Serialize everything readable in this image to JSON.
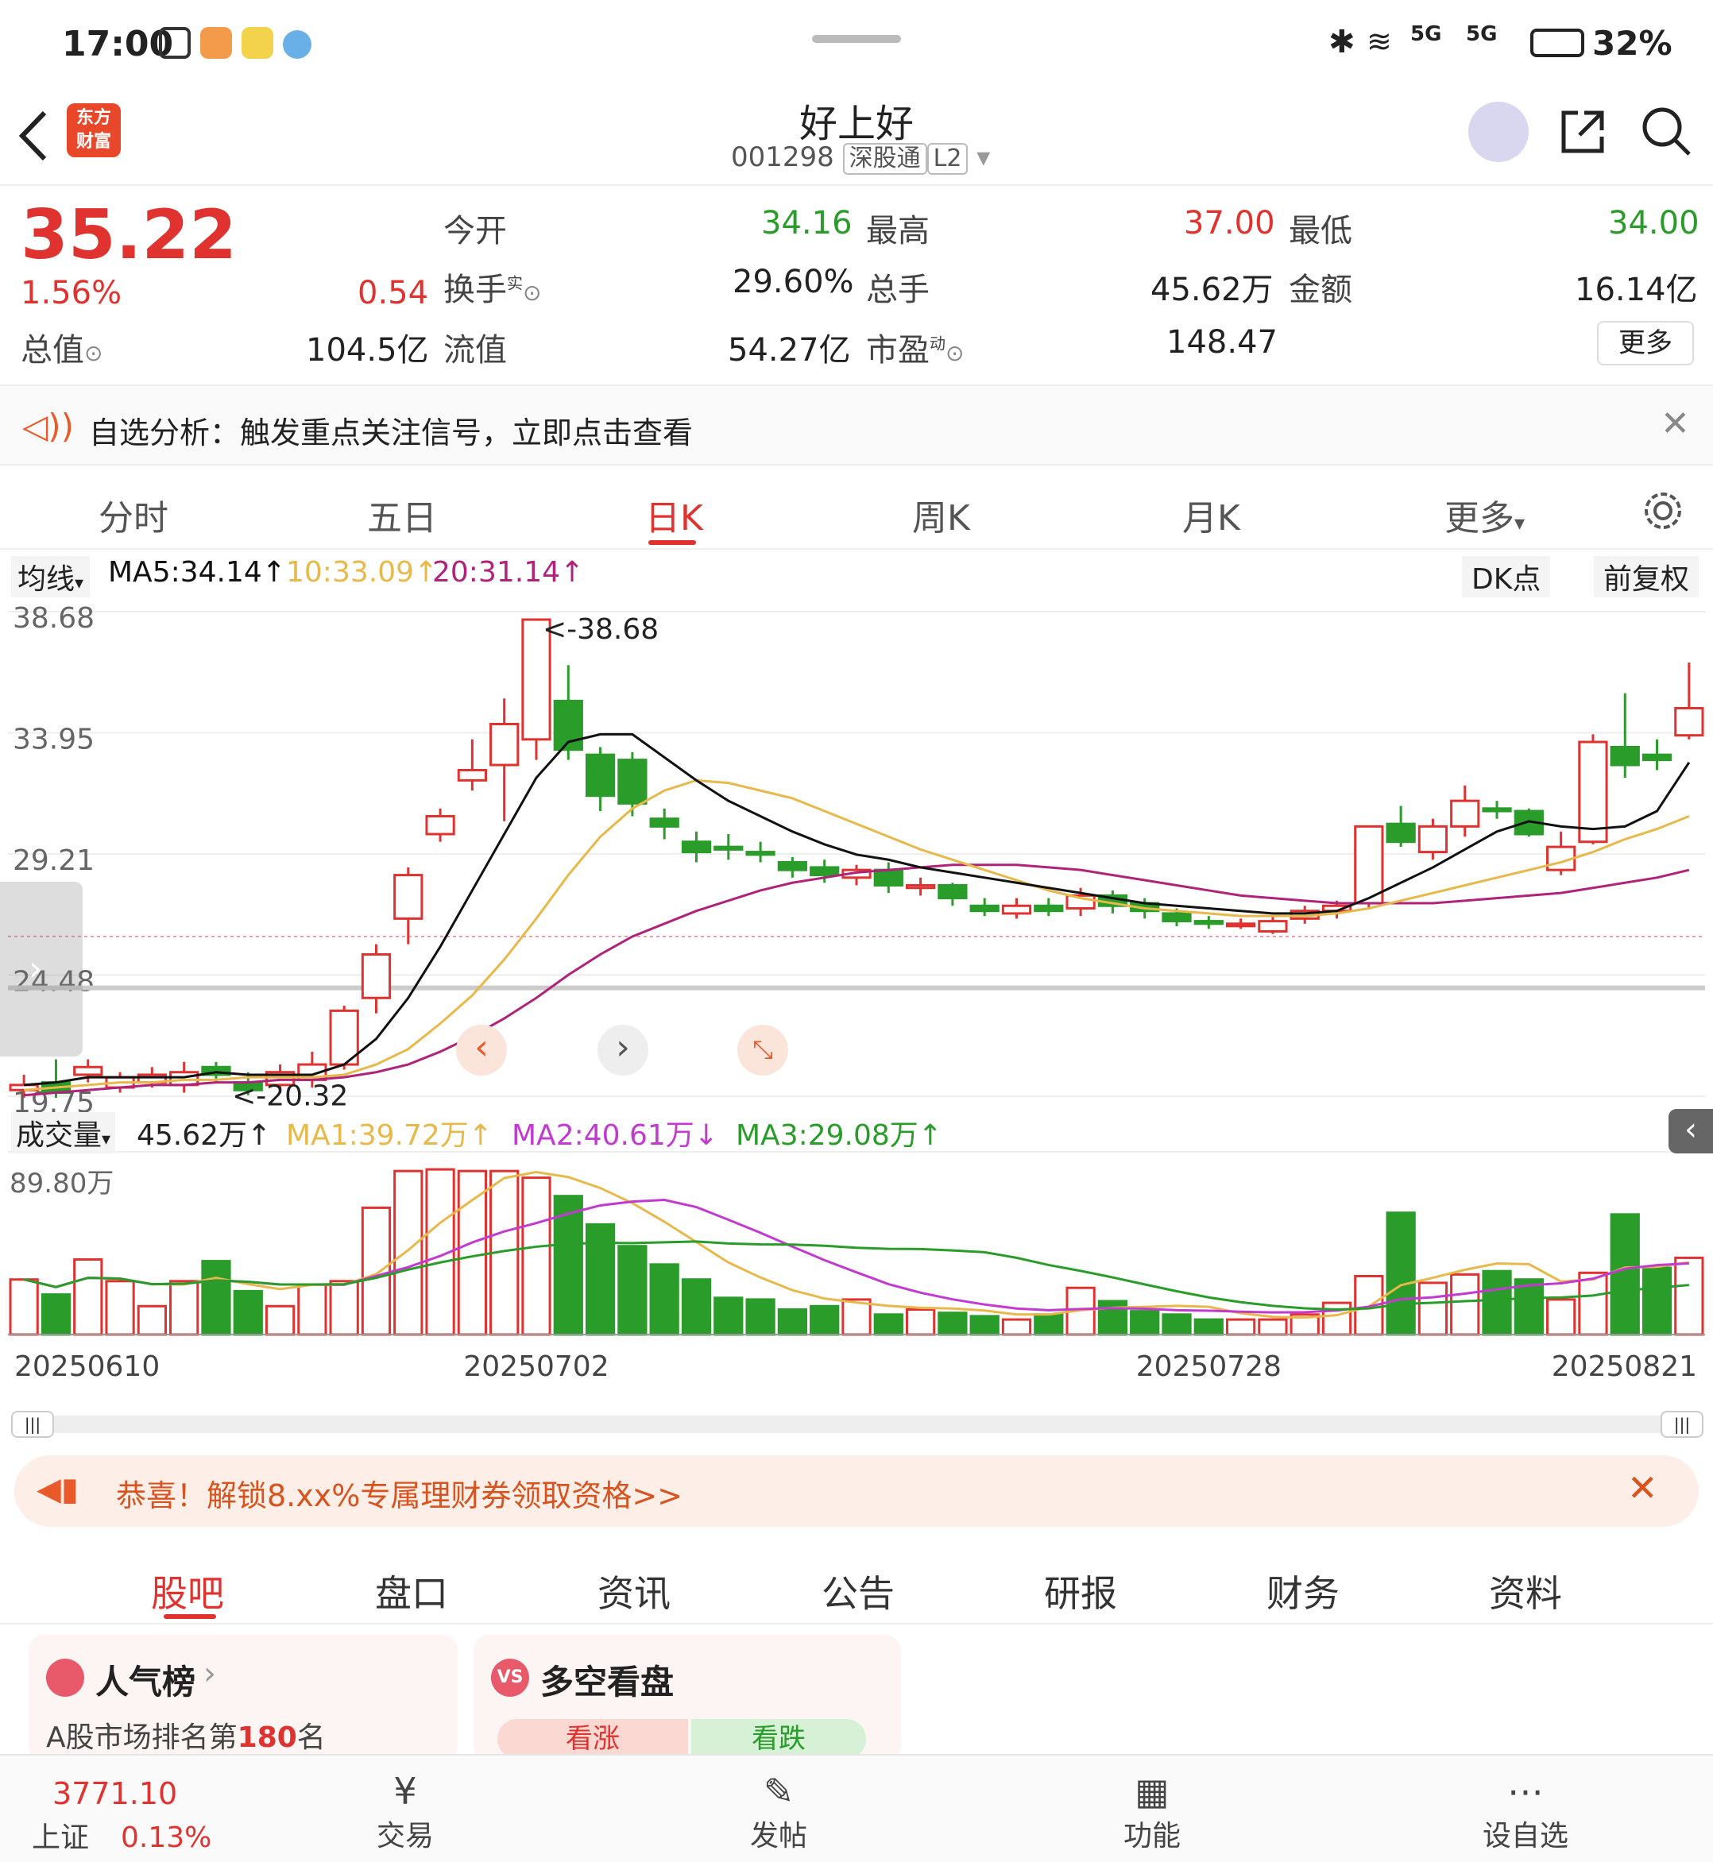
{
  "status": {
    "time": "17:00",
    "battery": "32%",
    "network_label": "5G"
  },
  "header": {
    "back_icon": "back-arrow-icon",
    "logo_line1": "东方",
    "logo_line2": "财富",
    "title": "好上好",
    "code": "001298",
    "badge_sh": "深股通",
    "badge_l2": "L2"
  },
  "quote": {
    "price": "35.22",
    "pct": "1.56%",
    "chg": "0.54",
    "total_value_label": "总值",
    "total_value": "104.5亿",
    "open_label": "今开",
    "open": "34.16",
    "turnover_label": "换手",
    "turnover_sup": "实",
    "turnover": "29.60%",
    "float_label": "流值",
    "float_value": "54.27亿",
    "high_label": "最高",
    "high": "37.00",
    "volume_label": "总手",
    "volume": "45.62万",
    "pe_label": "市盈",
    "pe_sup": "动",
    "pe": "148.47",
    "low_label": "最低",
    "low": "34.00",
    "amount_label": "金额",
    "amount": "16.14亿",
    "more": "更多"
  },
  "notice": {
    "text": "自选分析：触发重点关注信号，立即点击查看"
  },
  "ktabs": [
    "分时",
    "五日",
    "日K",
    "周K",
    "月K",
    "更多"
  ],
  "ma": {
    "label": "均线",
    "ma5": "MA5:34.14↑",
    "ma10": "10:33.09↑",
    "ma20": "20:31.14↑",
    "dk": "DK点",
    "fq": "前复权"
  },
  "chart_data": {
    "type": "candlestick",
    "ylabels": [
      "38.68",
      "33.95",
      "29.21",
      "24.48",
      "19.75"
    ],
    "ylim": [
      19.75,
      38.68
    ],
    "high_mark": "38.68",
    "low_mark": "20.32",
    "candles": [
      [
        20.3,
        20.5,
        20.0,
        20.9
      ],
      [
        20.6,
        20.2,
        20.0,
        21.5
      ],
      [
        20.9,
        21.2,
        20.6,
        21.5
      ],
      [
        20.4,
        20.8,
        20.2,
        21.0
      ],
      [
        20.6,
        20.9,
        20.4,
        21.2
      ],
      [
        20.5,
        21.0,
        20.2,
        21.4
      ],
      [
        21.2,
        20.9,
        20.6,
        21.4
      ],
      [
        20.6,
        20.3,
        20.1,
        21.0
      ],
      [
        20.5,
        21.0,
        20.2,
        21.3
      ],
      [
        20.7,
        21.3,
        20.4,
        21.8
      ],
      [
        21.3,
        23.4,
        21.1,
        23.6
      ],
      [
        23.9,
        25.6,
        23.3,
        26.0
      ],
      [
        27.0,
        28.7,
        26.0,
        29.0
      ],
      [
        30.3,
        31.0,
        30.0,
        31.3
      ],
      [
        32.4,
        32.8,
        32.0,
        34.0
      ],
      [
        33.0,
        34.6,
        30.8,
        35.6
      ],
      [
        34.0,
        38.68,
        33.2,
        38.68
      ],
      [
        35.5,
        33.6,
        33.2,
        36.9
      ],
      [
        33.4,
        31.8,
        31.2,
        33.7
      ],
      [
        33.2,
        31.5,
        31.0,
        33.5
      ],
      [
        30.9,
        30.6,
        30.1,
        31.3
      ],
      [
        30.0,
        29.6,
        29.2,
        30.4
      ],
      [
        29.8,
        29.7,
        29.3,
        30.3
      ],
      [
        29.6,
        29.5,
        29.2,
        30.0
      ],
      [
        29.2,
        28.9,
        28.6,
        29.4
      ],
      [
        29.0,
        28.7,
        28.4,
        29.3
      ],
      [
        28.6,
        28.9,
        28.3,
        29.1
      ],
      [
        28.9,
        28.3,
        28.0,
        29.2
      ],
      [
        28.2,
        28.3,
        27.9,
        28.6
      ],
      [
        28.3,
        27.8,
        27.5,
        28.4
      ],
      [
        27.5,
        27.3,
        27.1,
        27.8
      ],
      [
        27.2,
        27.5,
        27.0,
        27.8
      ],
      [
        27.5,
        27.3,
        27.1,
        27.8
      ],
      [
        27.4,
        27.9,
        27.1,
        28.2
      ],
      [
        27.9,
        27.5,
        27.2,
        28.1
      ],
      [
        27.6,
        27.3,
        27.0,
        27.8
      ],
      [
        27.2,
        26.9,
        26.7,
        27.4
      ],
      [
        26.9,
        26.8,
        26.6,
        27.1
      ],
      [
        26.8,
        26.8,
        26.6,
        27.0
      ],
      [
        26.5,
        26.9,
        26.4,
        27.1
      ],
      [
        27.0,
        27.3,
        26.8,
        27.5
      ],
      [
        27.3,
        27.5,
        27.0,
        27.7
      ],
      [
        27.6,
        30.6,
        27.4,
        30.6
      ],
      [
        30.7,
        30.0,
        29.8,
        31.4
      ],
      [
        29.6,
        30.6,
        29.3,
        30.9
      ],
      [
        30.6,
        31.6,
        30.2,
        32.2
      ],
      [
        31.3,
        31.2,
        30.9,
        31.6
      ],
      [
        31.2,
        30.3,
        30.2,
        31.3
      ],
      [
        28.9,
        29.8,
        28.7,
        30.4
      ],
      [
        30.0,
        33.9,
        29.9,
        34.2
      ],
      [
        33.7,
        33.0,
        32.5,
        35.8
      ],
      [
        33.4,
        33.2,
        32.8,
        34.0
      ],
      [
        34.16,
        35.22,
        34.0,
        37.0
      ]
    ],
    "ma5": [
      20.5,
      20.6,
      20.8,
      20.8,
      20.8,
      20.8,
      21.0,
      20.9,
      20.9,
      20.9,
      21.3,
      22.3,
      23.9,
      25.9,
      28.1,
      30.3,
      32.5,
      33.9,
      34.2,
      34.2,
      33.3,
      32.4,
      31.6,
      31.0,
      30.4,
      29.9,
      29.5,
      29.3,
      29.0,
      28.8,
      28.6,
      28.4,
      28.2,
      28.0,
      27.8,
      27.6,
      27.5,
      27.4,
      27.3,
      27.2,
      27.2,
      27.3,
      27.8,
      28.4,
      29.0,
      29.7,
      30.4,
      30.8,
      30.6,
      30.5,
      30.6,
      31.2,
      33.1
    ],
    "ma10": [
      20.3,
      20.4,
      20.5,
      20.6,
      20.6,
      20.7,
      20.7,
      20.8,
      20.8,
      20.8,
      20.9,
      21.3,
      21.9,
      22.9,
      24.0,
      25.4,
      27.0,
      28.7,
      30.2,
      31.3,
      32.0,
      32.4,
      32.3,
      32.0,
      31.7,
      31.2,
      30.7,
      30.2,
      29.7,
      29.3,
      28.9,
      28.5,
      28.1,
      27.8,
      27.6,
      27.4,
      27.3,
      27.2,
      27.1,
      27.1,
      27.1,
      27.2,
      27.4,
      27.7,
      28.0,
      28.3,
      28.6,
      28.9,
      29.2,
      29.6,
      30.1,
      30.5,
      31.0
    ],
    "ma20": [
      20.1,
      20.2,
      20.3,
      20.4,
      20.5,
      20.5,
      20.6,
      20.6,
      20.7,
      20.7,
      20.8,
      21.0,
      21.3,
      21.8,
      22.4,
      23.1,
      23.9,
      24.8,
      25.6,
      26.3,
      26.8,
      27.3,
      27.7,
      28.1,
      28.4,
      28.6,
      28.8,
      28.9,
      29.0,
      29.1,
      29.1,
      29.1,
      29.0,
      28.9,
      28.7,
      28.5,
      28.3,
      28.1,
      27.9,
      27.8,
      27.7,
      27.6,
      27.6,
      27.6,
      27.6,
      27.7,
      27.8,
      27.9,
      28.0,
      28.2,
      28.4,
      28.6,
      28.9
    ],
    "vol_label": "成交量",
    "vol_now": "45.62万↑",
    "vol_ma1": "MA1:39.72万↑",
    "vol_ma2": "MA2:40.61万↓",
    "vol_ma3": "MA3:29.08万↑",
    "vol_max": "89.80万",
    "volumes": [
      33,
      24,
      45,
      32,
      17,
      32,
      44,
      26,
      17,
      30,
      32,
      76,
      98,
      99,
      98,
      98,
      94,
      83,
      66,
      53,
      42,
      33,
      22,
      21,
      15,
      17,
      21,
      12,
      15,
      13,
      11,
      9,
      12,
      28,
      20,
      14,
      12,
      9,
      9,
      9,
      12,
      19,
      35,
      73,
      31,
      36,
      38,
      33,
      21,
      37,
      72,
      40,
      46
    ],
    "dates": [
      "20250610",
      "20250702",
      "20250728",
      "20250821"
    ]
  },
  "promo": {
    "text": "恭喜！解锁8.xx%专属理财券领取资格>>"
  },
  "btabs": [
    "股吧",
    "盘口",
    "资讯",
    "公告",
    "研报",
    "财务",
    "资料"
  ],
  "cards": {
    "popular_title": "人气榜",
    "popular_sub_pre": "A股市场排名第",
    "popular_rank": "180",
    "popular_sub_post": "名",
    "vs_title": "多空看盘",
    "bull": "看涨",
    "bear": "看跌"
  },
  "nav": {
    "index_value": "3771.10",
    "index_name": "上证",
    "index_pct": "0.13%",
    "trade": "交易",
    "post": "发帖",
    "func": "功能",
    "watch": "设自选"
  },
  "colors": {
    "up": "#e0322f",
    "down": "#2a9c2a",
    "ma5": "#111111",
    "ma10": "#e8b84a",
    "ma20": "#b0237a"
  }
}
